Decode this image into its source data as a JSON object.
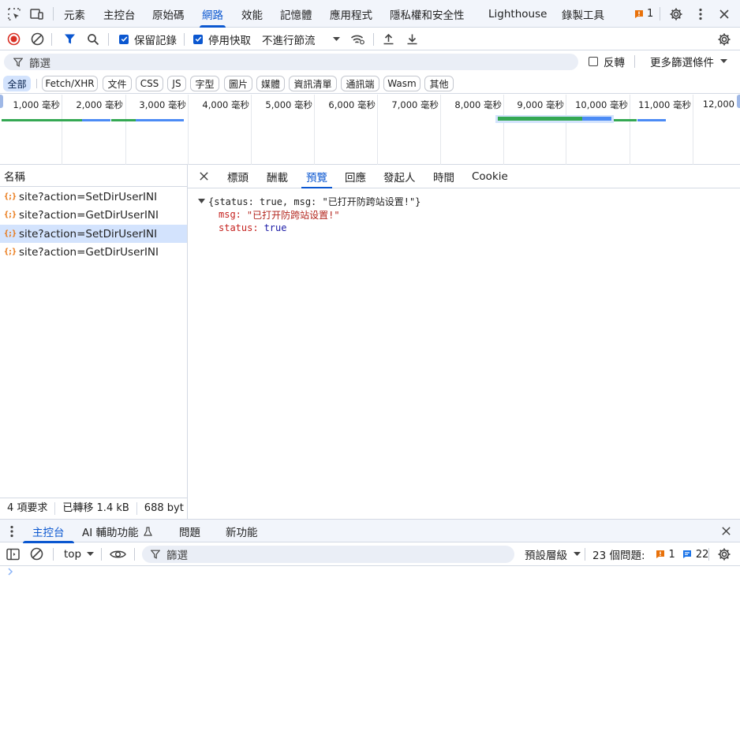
{
  "top_tabs": [
    "元素",
    "主控台",
    "原始碼",
    "網路",
    "效能",
    "記憶體",
    "應用程式",
    "隱私權和安全性",
    "Lighthouse",
    "錄製工具"
  ],
  "active_top_tab": "網路",
  "issues_badge_count": "1",
  "toolbar": {
    "preserve_log_label": "保留記錄",
    "disable_cache_label": "停用快取",
    "throttling_value": "不進行節流"
  },
  "filter": {
    "placeholder": "篩選",
    "invert_label": "反轉",
    "more_filters_label": "更多篩選條件"
  },
  "type_chips": [
    "全部",
    "Fetch/XHR",
    "文件",
    "CSS",
    "JS",
    "字型",
    "圖片",
    "媒體",
    "資訊清單",
    "通訊端",
    "Wasm",
    "其他"
  ],
  "timeline_labels": [
    "1,000 毫秒",
    "2,000 毫秒",
    "3,000 毫秒",
    "4,000 毫秒",
    "5,000 毫秒",
    "6,000 毫秒",
    "7,000 毫秒",
    "8,000 毫秒",
    "9,000 毫秒",
    "10,000 毫秒",
    "11,000 毫秒",
    "12,000"
  ],
  "list": {
    "header": "名稱",
    "requests": [
      "site?action=SetDirUserINI",
      "site?action=GetDirUserINI",
      "site?action=SetDirUserINI",
      "site?action=GetDirUserINI"
    ],
    "selected_index": 2
  },
  "status": {
    "requests": "4 項要求",
    "transferred": "已轉移 1.4 kB",
    "resources": "688 byt"
  },
  "detail_tabs": [
    "標頭",
    "酬載",
    "預覽",
    "回應",
    "發起人",
    "時間",
    "Cookie"
  ],
  "active_detail_tab": "預覽",
  "preview": {
    "summary": "{status: true, msg: \"已打开防跨站设置!\"}",
    "msg_key": "msg:",
    "msg_value": "\"已打开防跨站设置!\"",
    "status_key": "status:",
    "status_value": "true"
  },
  "drawer_tabs": [
    "主控台",
    "AI 輔助功能",
    "問題",
    "新功能"
  ],
  "console_toolbar": {
    "context": "top",
    "filter_placeholder": "篩選",
    "levels": "預設層級",
    "issues_label": "23 個問題:",
    "issues_error_count": "1",
    "issues_info_count": "22"
  },
  "colors": {
    "accent": "#0b57d0",
    "record_red": "#d93025",
    "request_icon": "#e8710a",
    "waterfall_green": "#34a853",
    "waterfall_blue": "#4c8bf5"
  }
}
